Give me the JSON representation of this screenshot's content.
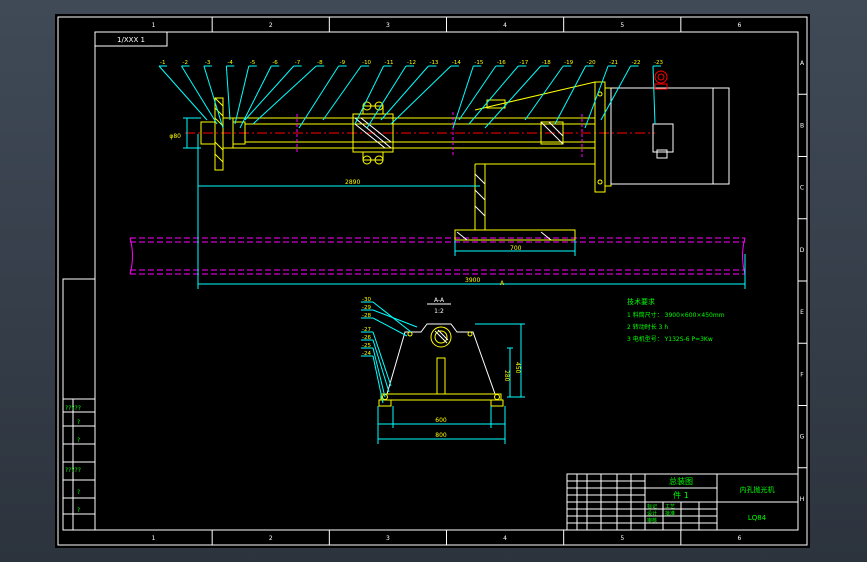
{
  "drawing": {
    "title_block": {
      "drawing_name": "总装图",
      "sheet": "件 1",
      "machine_name": "内孔抛光机",
      "drawing_code": "LQ84",
      "row_labels": [
        "标记",
        "设计",
        "审核",
        "工艺",
        "批准"
      ]
    },
    "stamp": "1/XXX 1",
    "section_label": "A-A",
    "section_scale": "1:2",
    "column_numbers": [
      "1",
      "2",
      "3",
      "4",
      "5",
      "6"
    ],
    "row_letters": [
      "A",
      "B",
      "C",
      "D",
      "E",
      "F",
      "G",
      "H"
    ],
    "tech_requirements": {
      "heading": "技术要求",
      "lines": [
        "1 料筒尺寸： 3900×600×450mm",
        "2 转动时长 3 h",
        "3 电机型号： Y132S-6 P=3Kw"
      ]
    },
    "left_table_labels": [
      "?????",
      "?",
      "?",
      "?????",
      "?",
      "?"
    ],
    "part_numbers_top": [
      "1",
      "2",
      "3",
      "4",
      "5",
      "6",
      "7",
      "8",
      "9",
      "10",
      "11",
      "12",
      "13",
      "14",
      "15",
      "16",
      "17",
      "18",
      "19",
      "20",
      "21",
      "22",
      "23"
    ],
    "part_numbers_section": [
      "30",
      "29",
      "28",
      "27",
      "26",
      "25",
      "24"
    ],
    "dimensions": {
      "shaft_length": "2890",
      "base_width": "700",
      "overall_length": "3900",
      "section_width": "800",
      "section_inner": "600",
      "section_height": "450",
      "section_height2": "280",
      "flange_dia": "φ80"
    },
    "colors": {
      "sheet": "#000000",
      "border": "#ffffff",
      "outline": "#ffff00",
      "center": "#ff0000",
      "hidden": "#ff00ff",
      "dim": "#00ffff",
      "text": "#00ff00"
    }
  }
}
